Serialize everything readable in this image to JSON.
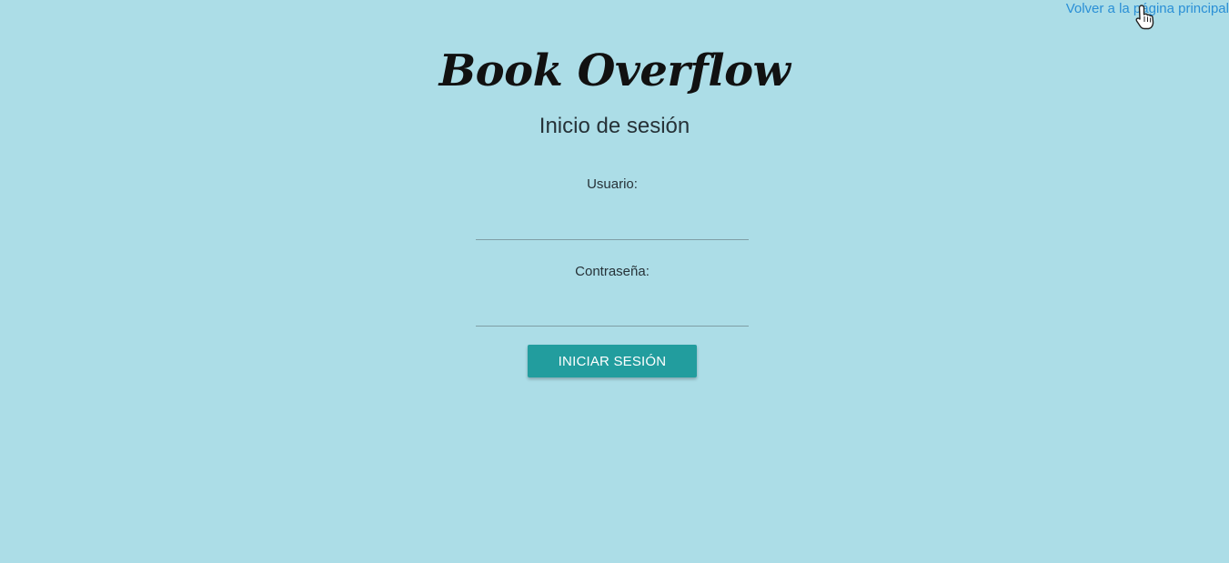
{
  "header": {
    "back_link_label": "Volver a la página principal"
  },
  "brand": {
    "title": "Book Overflow"
  },
  "login": {
    "title": "Inicio de sesión",
    "username_label": "Usuario:",
    "username_value": "",
    "password_label": "Contraseña:",
    "password_value": "",
    "submit_label": "INICIAR SESIÓN"
  },
  "icons": {
    "cursor": "hand-pointer-icon"
  },
  "colors": {
    "background": "#acdde7",
    "link": "#2a8fd6",
    "button": "#229d9e",
    "button_text": "#ffffff"
  }
}
